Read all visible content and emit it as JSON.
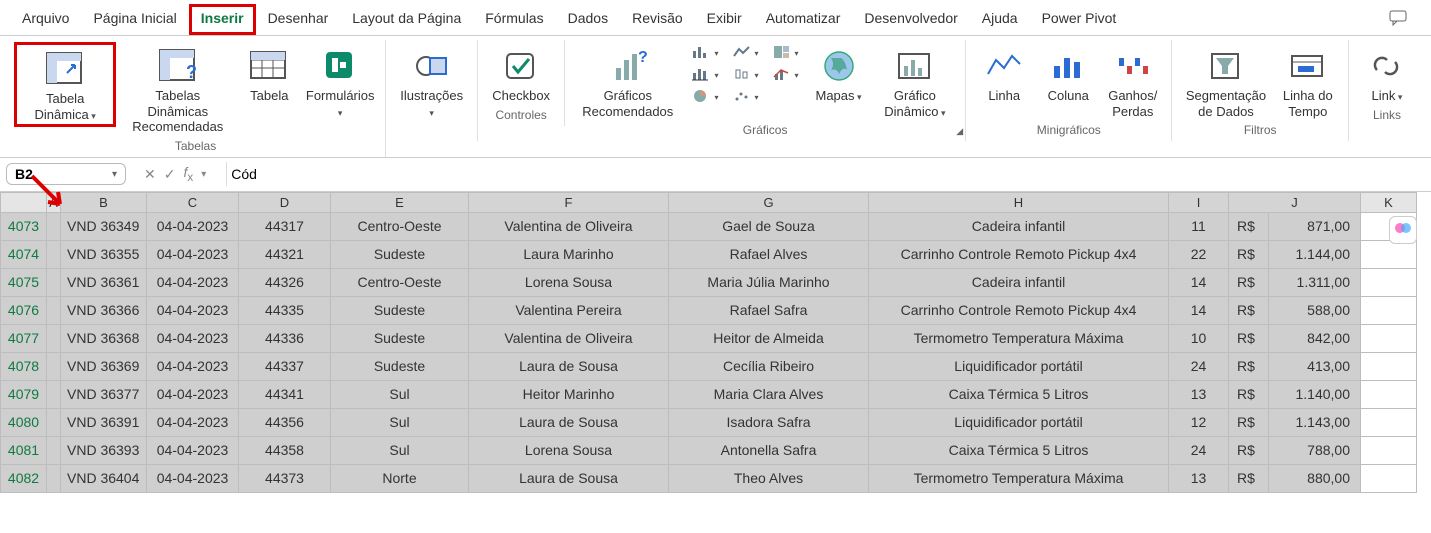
{
  "menu": {
    "arquivo": "Arquivo",
    "pagina_inicial": "Página Inicial",
    "inserir": "Inserir",
    "desenhar": "Desenhar",
    "layout": "Layout da Página",
    "formulas": "Fórmulas",
    "dados": "Dados",
    "revisao": "Revisão",
    "exibir": "Exibir",
    "automatizar": "Automatizar",
    "desenvolvedor": "Desenvolvedor",
    "ajuda": "Ajuda",
    "powerpivot": "Power Pivot"
  },
  "ribbon": {
    "tabelas": {
      "pivot": "Tabela Dinâmica",
      "rec_pivot": "Tabelas Dinâmicas Recomendadas",
      "tabela": "Tabela",
      "form": "Formulários",
      "label": "Tabelas"
    },
    "ilustr": {
      "btn": "Ilustrações",
      "label": ""
    },
    "controles": {
      "checkbox": "Checkbox",
      "label": "Controles"
    },
    "graficos": {
      "rec": "Gráficos Recomendados",
      "mapas": "Mapas",
      "dyn": "Gráfico Dinâmico",
      "label": "Gráficos"
    },
    "mini": {
      "linha": "Linha",
      "coluna": "Coluna",
      "ganhos": "Ganhos/ Perdas",
      "label": "Minigráficos"
    },
    "filtros": {
      "seg": "Segmentação de Dados",
      "tempo": "Linha do Tempo",
      "label": "Filtros"
    },
    "links": {
      "link": "Link",
      "label": "Links"
    }
  },
  "namebox": "B2",
  "formula": "Cód",
  "columns": [
    "A",
    "B",
    "C",
    "D",
    "E",
    "F",
    "G",
    "H",
    "I",
    "J",
    "K"
  ],
  "row_headers": [
    "4073",
    "4074",
    "4075",
    "4076",
    "4077",
    "4078",
    "4079",
    "4080",
    "4081",
    "4082"
  ],
  "currency": "R$",
  "chart_data": {
    "type": "table",
    "columns": [
      "B",
      "C",
      "D",
      "E",
      "F",
      "G",
      "H",
      "I",
      "J_currency",
      "J_value"
    ],
    "rows": [
      [
        "VND 36349",
        "04-04-2023",
        "44317",
        "Centro-Oeste",
        "Valentina de Oliveira",
        "Gael de Souza",
        "Cadeira infantil",
        "11",
        "R$",
        "871,00"
      ],
      [
        "VND 36355",
        "04-04-2023",
        "44321",
        "Sudeste",
        "Laura Marinho",
        "Rafael Alves",
        "Carrinho Controle Remoto Pickup 4x4",
        "22",
        "R$",
        "1.144,00"
      ],
      [
        "VND 36361",
        "04-04-2023",
        "44326",
        "Centro-Oeste",
        "Lorena Sousa",
        "Maria Júlia Marinho",
        "Cadeira infantil",
        "14",
        "R$",
        "1.311,00"
      ],
      [
        "VND 36366",
        "04-04-2023",
        "44335",
        "Sudeste",
        "Valentina Pereira",
        "Rafael Safra",
        "Carrinho Controle Remoto Pickup 4x4",
        "14",
        "R$",
        "588,00"
      ],
      [
        "VND 36368",
        "04-04-2023",
        "44336",
        "Sudeste",
        "Valentina de Oliveira",
        "Heitor de Almeida",
        "Termometro Temperatura Máxima",
        "10",
        "R$",
        "842,00"
      ],
      [
        "VND 36369",
        "04-04-2023",
        "44337",
        "Sudeste",
        "Laura de Sousa",
        "Cecília Ribeiro",
        "Liquidificador portátil",
        "24",
        "R$",
        "413,00"
      ],
      [
        "VND 36377",
        "04-04-2023",
        "44341",
        "Sul",
        "Heitor Marinho",
        "Maria Clara Alves",
        "Caixa Térmica 5 Litros",
        "13",
        "R$",
        "1.140,00"
      ],
      [
        "VND 36391",
        "04-04-2023",
        "44356",
        "Sul",
        "Laura de Sousa",
        "Isadora Safra",
        "Liquidificador portátil",
        "12",
        "R$",
        "1.143,00"
      ],
      [
        "VND 36393",
        "04-04-2023",
        "44358",
        "Sul",
        "Lorena Sousa",
        "Antonella Safra",
        "Caixa Térmica 5 Litros",
        "24",
        "R$",
        "788,00"
      ],
      [
        "VND 36404",
        "04-04-2023",
        "44373",
        "Norte",
        "Laura de Sousa",
        "Theo Alves",
        "Termometro Temperatura Máxima",
        "13",
        "R$",
        "880,00"
      ]
    ]
  }
}
